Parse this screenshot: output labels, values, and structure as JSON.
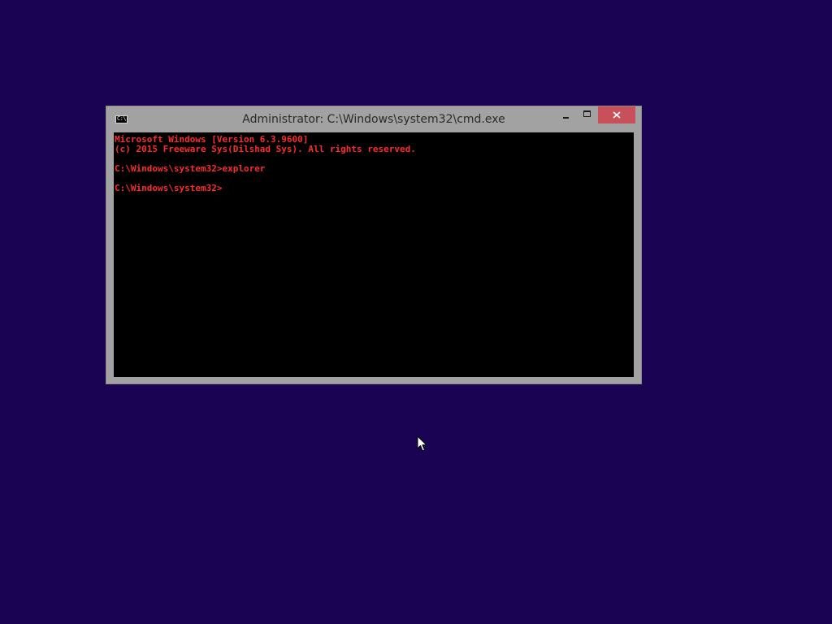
{
  "window": {
    "title": "Administrator: C:\\Windows\\system32\\cmd.exe",
    "icon": "cmd-icon",
    "icon_text": "C:\\",
    "controls": {
      "minimize": "minimize-icon",
      "maximize": "maximize-icon",
      "close": "close-icon"
    }
  },
  "console": {
    "lines": [
      "Microsoft Windows [Version 6.3.9600]",
      "(c) 2015 Freeware Sys(Dilshad Sys). All rights reserved.",
      "",
      "C:\\Windows\\system32>explorer",
      "",
      "C:\\Windows\\system32>"
    ],
    "text_color": "#ff2a2a",
    "background_color": "#000000"
  },
  "desktop": {
    "background_color": "#190352",
    "cursor": "mouse-pointer-icon"
  },
  "colors": {
    "window_frame": "#a2a2a2",
    "close_button": "#c7505a"
  }
}
